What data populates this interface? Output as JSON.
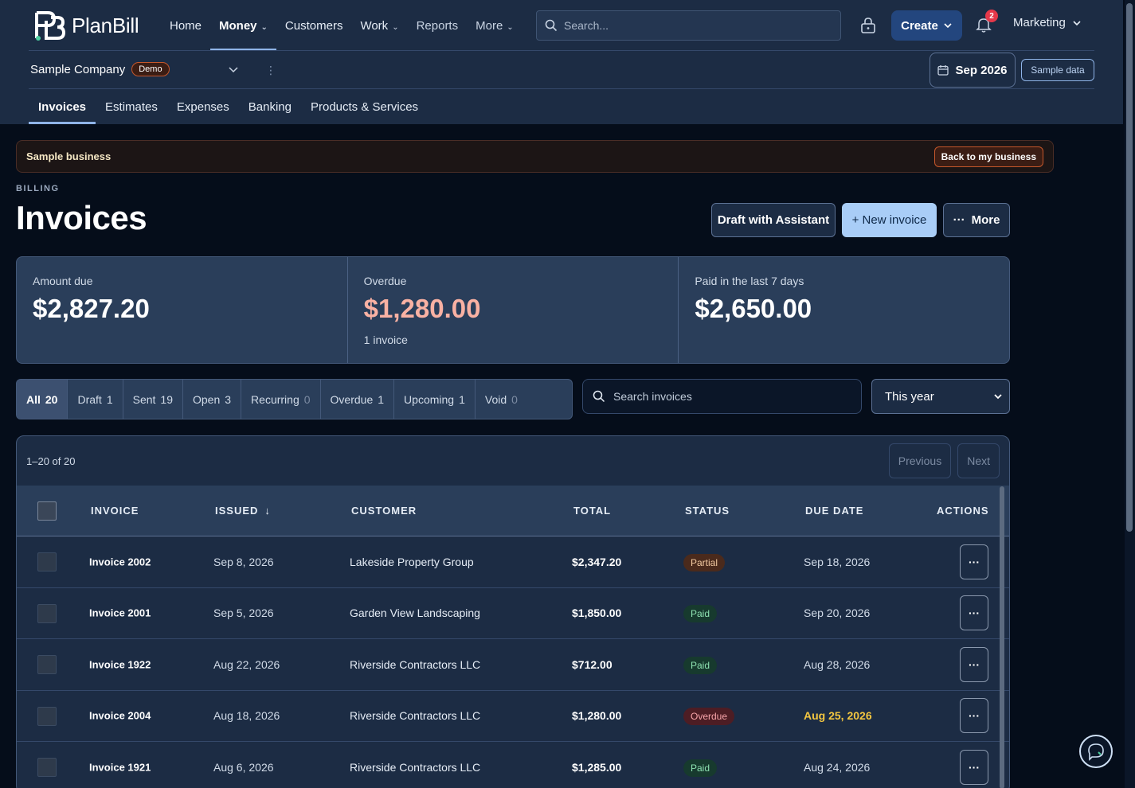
{
  "brand": {
    "name": "PlanBill"
  },
  "nav": {
    "items": [
      {
        "label": "Home",
        "caret": false,
        "active": false
      },
      {
        "label": "Money",
        "caret": true,
        "active": true
      },
      {
        "label": "Customers",
        "caret": false,
        "active": false
      },
      {
        "label": "Work",
        "caret": true,
        "active": false
      },
      {
        "label": "Reports",
        "caret": false,
        "active": false
      },
      {
        "label": "More",
        "caret": true,
        "active": false
      }
    ],
    "search_placeholder": "Search...",
    "create_label": "Create",
    "notification_count": "2",
    "workspace": "Marketing"
  },
  "company": {
    "name": "Sample Company",
    "badge": "Demo"
  },
  "period_button": "Sep 2026",
  "sample_data_label": "Sample data",
  "subnav": [
    "Invoices",
    "Estimates",
    "Expenses",
    "Banking",
    "Products & Services"
  ],
  "banner": {
    "text": "Sample business",
    "button": "Back to my business"
  },
  "header": {
    "eyebrow": "BILLING",
    "title": "Invoices",
    "draft_button": "Draft with Assistant",
    "new_button": "+ New invoice",
    "more_button": "More"
  },
  "summary": [
    {
      "label": "Amount due",
      "value": "$2,827.20",
      "sub": ""
    },
    {
      "label": "Overdue",
      "value": "$1,280.00",
      "sub": "1 invoice"
    },
    {
      "label": "Paid in the last 7 days",
      "value": "$2,650.00",
      "sub": ""
    }
  ],
  "filters": [
    {
      "label": "All",
      "count": "20"
    },
    {
      "label": "Draft",
      "count": "1"
    },
    {
      "label": "Sent",
      "count": "19"
    },
    {
      "label": "Open",
      "count": "3"
    },
    {
      "label": "Recurring",
      "count": "0"
    },
    {
      "label": "Overdue",
      "count": "1"
    },
    {
      "label": "Upcoming",
      "count": "1"
    },
    {
      "label": "Void",
      "count": "0"
    }
  ],
  "invoice_search_placeholder": "Search invoices",
  "period_select": "This year",
  "table": {
    "range": "1–20 of 20",
    "prev": "Previous",
    "next": "Next",
    "columns": {
      "invoice": "INVOICE",
      "issued": "ISSUED",
      "customer": "CUSTOMER",
      "total": "TOTAL",
      "status": "STATUS",
      "due": "DUE DATE",
      "actions": "ACTIONS"
    },
    "rows": [
      {
        "invoice": "Invoice 2002",
        "issued": "Sep 8, 2026",
        "customer": "Lakeside Property Group",
        "total": "$2,347.20",
        "status": "Partial",
        "due": "Sep 18, 2026"
      },
      {
        "invoice": "Invoice 2001",
        "issued": "Sep 5, 2026",
        "customer": "Garden View Landscaping",
        "total": "$1,850.00",
        "status": "Paid",
        "due": "Sep 20, 2026"
      },
      {
        "invoice": "Invoice 1922",
        "issued": "Aug 22, 2026",
        "customer": "Riverside Contractors LLC",
        "total": "$712.00",
        "status": "Paid",
        "due": "Aug 28, 2026"
      },
      {
        "invoice": "Invoice 2004",
        "issued": "Aug 18, 2026",
        "customer": "Riverside Contractors LLC",
        "total": "$1,280.00",
        "status": "Overdue",
        "due": "Aug 25, 2026"
      },
      {
        "invoice": "Invoice 1921",
        "issued": "Aug 6, 2026",
        "customer": "Riverside Contractors LLC",
        "total": "$1,285.00",
        "status": "Paid",
        "due": "Aug 24, 2026"
      }
    ]
  }
}
